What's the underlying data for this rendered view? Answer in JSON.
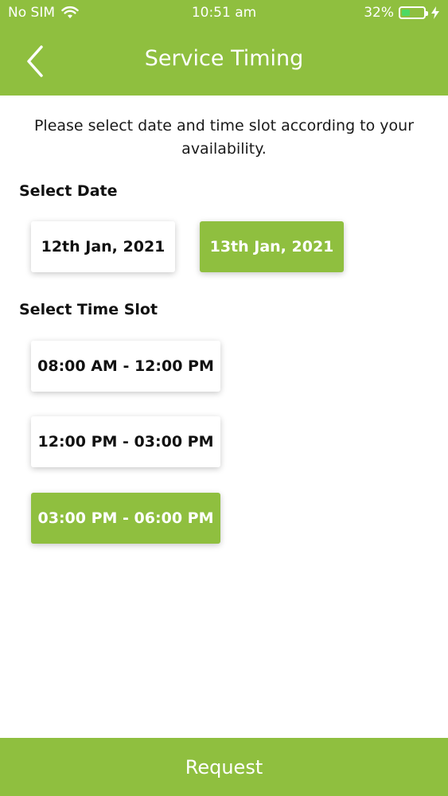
{
  "status_bar": {
    "carrier": "No SIM",
    "time": "10:51 am",
    "battery": "32%",
    "battery_level": 0.32
  },
  "header": {
    "title": "Service Timing",
    "back_icon": "chevron-left-icon"
  },
  "instruction": "Please select date and time slot according to your availability.",
  "date_section": {
    "label": "Select Date",
    "options": [
      {
        "label": "12th Jan, 2021",
        "selected": false
      },
      {
        "label": "13th Jan, 2021",
        "selected": true
      }
    ]
  },
  "time_section": {
    "label": "Select Time Slot",
    "options": [
      {
        "label": "08:00 AM - 12:00 PM",
        "selected": false
      },
      {
        "label": "12:00 PM - 03:00 PM",
        "selected": false
      },
      {
        "label": "03:00 PM - 06:00 PM",
        "selected": true
      }
    ]
  },
  "request_button": {
    "label": "Request"
  },
  "colors": {
    "accent": "#8fbf3f",
    "battery_fill": "#4cd964"
  }
}
